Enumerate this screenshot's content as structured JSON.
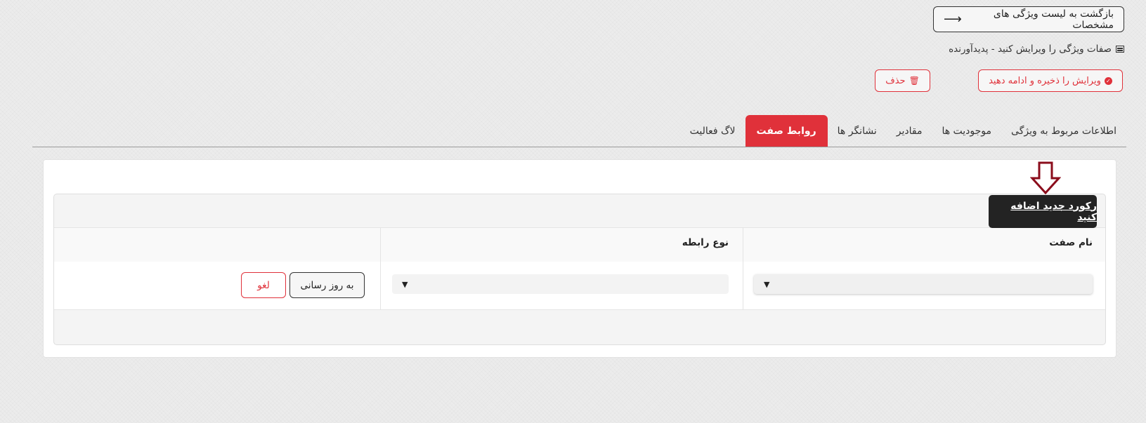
{
  "header": {
    "back_label": "بازگشت به لیست ویژگی های مشخصات",
    "back_icon": "arrow-right-icon",
    "page_title": "صفات ویژگی را ویرایش کنید - پدیدآورنده",
    "title_icon": "list-icon"
  },
  "actions": {
    "save_label": "ویرایش را ذخیره و ادامه دهید",
    "delete_label": "حذف"
  },
  "tabs": [
    {
      "label": "اطلاعات مربوط به ویژگی"
    },
    {
      "label": "موجودیت ها"
    },
    {
      "label": "مقادیر"
    },
    {
      "label": "نشانگر ها"
    },
    {
      "label": "روابط صفت",
      "active": true
    },
    {
      "label": "لاگ فعالیت"
    }
  ],
  "grid": {
    "add_record_label": "رکورد جدید اضافه کنید",
    "columns": [
      "نام صفت",
      "نوع رابطه",
      ""
    ],
    "row": {
      "attribute_name": "",
      "relation_type": "",
      "update_label": "به روز رسانی",
      "cancel_label": "لغو"
    }
  },
  "colors": {
    "accent": "#e0313a",
    "dark": "#232323",
    "annotation_arrow": "#8b0d1c"
  }
}
